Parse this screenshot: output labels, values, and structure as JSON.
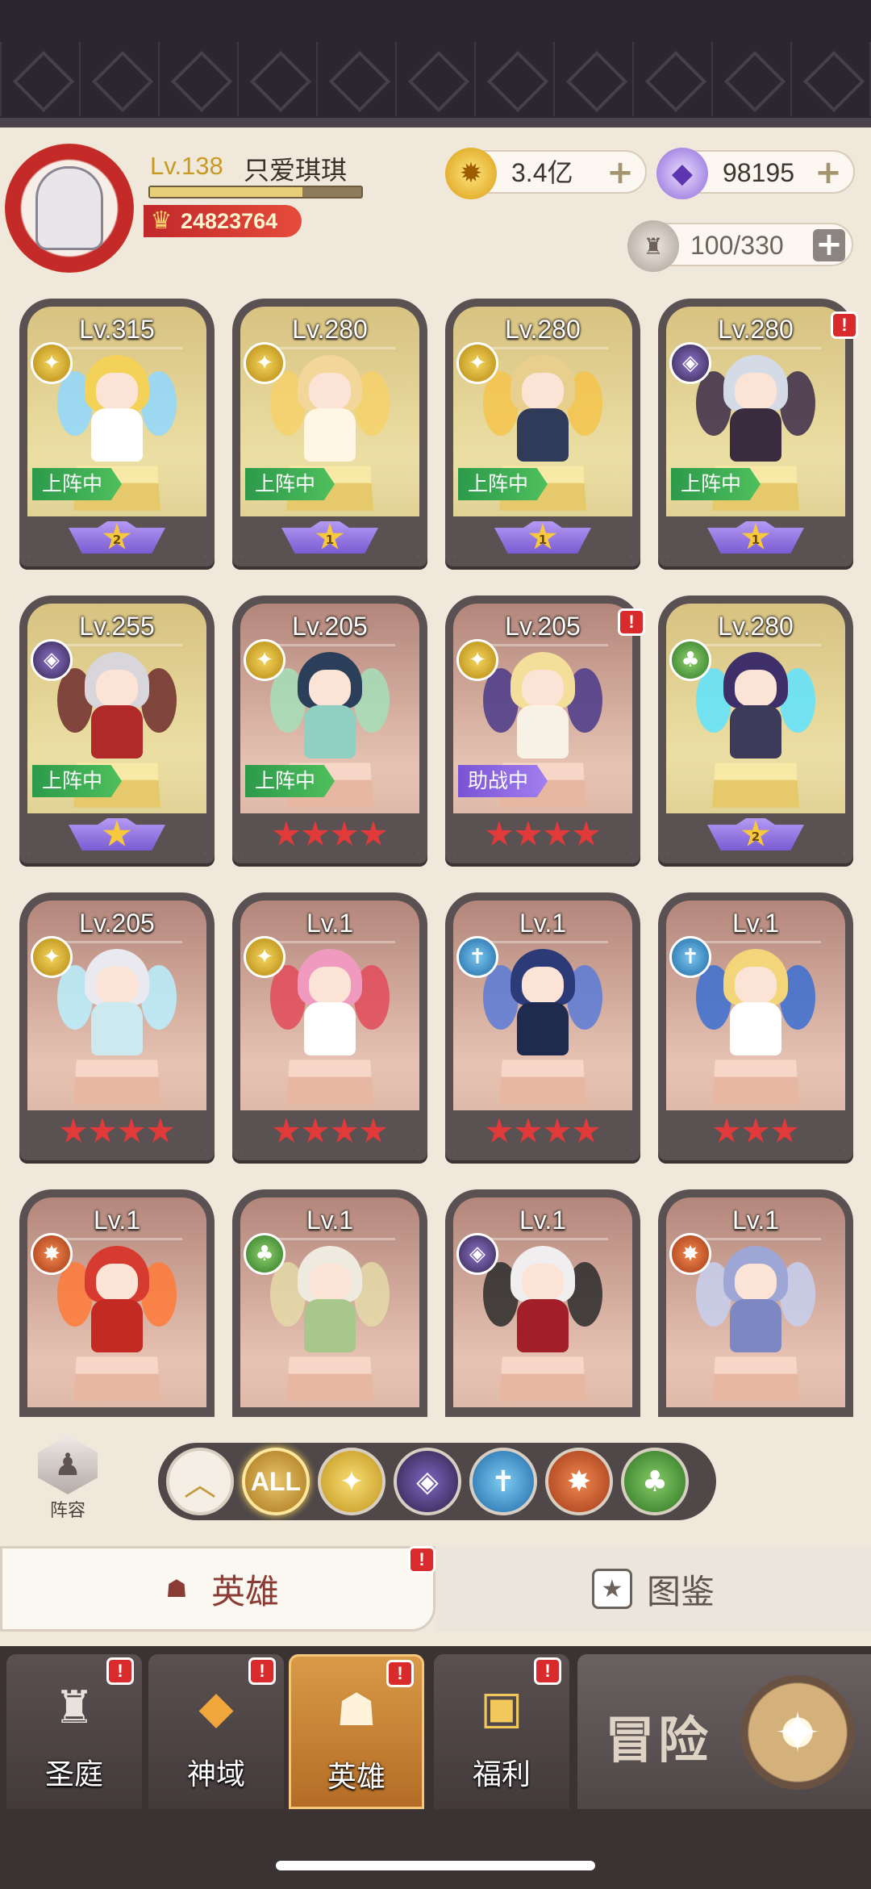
{
  "player": {
    "level": "Lv.138",
    "name": "只爱琪琪",
    "power": "24823764",
    "xp_fraction": 0.72
  },
  "resources": {
    "gold": "3.4亿",
    "gems": "98195",
    "capacity": "100/330"
  },
  "heroes": [
    {
      "level": "Lv.315",
      "faction": "gold",
      "status": "上阵中",
      "stars": "2",
      "badge": "purple",
      "alert": false
    },
    {
      "level": "Lv.280",
      "faction": "gold",
      "status": "上阵中",
      "stars": "1",
      "badge": "purple",
      "alert": false
    },
    {
      "level": "Lv.280",
      "faction": "gold",
      "status": "上阵中",
      "stars": "1",
      "badge": "purple",
      "alert": false
    },
    {
      "level": "Lv.280",
      "faction": "dark",
      "status": "上阵中",
      "stars": "1",
      "badge": "purple",
      "alert": true
    },
    {
      "level": "Lv.255",
      "faction": "dark",
      "status": "上阵中",
      "stars": "",
      "badge": "purple",
      "alert": false
    },
    {
      "level": "Lv.205",
      "faction": "gold",
      "status": "上阵中",
      "stars": 4,
      "badge": "red",
      "alert": false
    },
    {
      "level": "Lv.205",
      "faction": "gold",
      "status": "助战中",
      "stars": 4,
      "badge": "red",
      "alert": true
    },
    {
      "level": "Lv.280",
      "faction": "tree",
      "status": "",
      "stars": "2",
      "badge": "purple",
      "alert": false
    },
    {
      "level": "Lv.205",
      "faction": "gold",
      "status": "",
      "stars": 4,
      "badge": "red",
      "alert": false
    },
    {
      "level": "Lv.1",
      "faction": "gold",
      "status": "",
      "stars": 4,
      "badge": "red",
      "alert": false
    },
    {
      "level": "Lv.1",
      "faction": "blue",
      "status": "",
      "stars": 4,
      "badge": "red",
      "alert": false
    },
    {
      "level": "Lv.1",
      "faction": "blue",
      "status": "",
      "stars": 3,
      "badge": "red",
      "alert": false
    },
    {
      "level": "Lv.1",
      "faction": "fire",
      "status": "",
      "stars": 0,
      "badge": "red",
      "alert": false
    },
    {
      "level": "Lv.1",
      "faction": "tree",
      "status": "",
      "stars": 0,
      "badge": "red",
      "alert": false
    },
    {
      "level": "Lv.1",
      "faction": "dark",
      "status": "",
      "stars": 0,
      "badge": "red",
      "alert": false
    },
    {
      "level": "Lv.1",
      "faction": "fire",
      "status": "",
      "stars": 0,
      "badge": "red",
      "alert": false
    }
  ],
  "filters": {
    "lineup_label": "阵容",
    "all_label": "ALL",
    "icons": [
      "collapse-icon",
      "all",
      "light-faction-icon",
      "dark-faction-icon",
      "holy-faction-icon",
      "wild-faction-icon",
      "nature-faction-icon"
    ]
  },
  "subtabs": {
    "heroes": "英雄",
    "codex": "图鉴",
    "alert": "!"
  },
  "nav": {
    "sanctum": "圣庭",
    "divine": "神域",
    "heroes": "英雄",
    "welfare": "福利",
    "adventure": "冒险",
    "alert": "!"
  },
  "colors": {
    "accent": "#d99a48",
    "alert": "#d92b2b",
    "status_green": "#2c9a4a",
    "status_purple": "#7a53d6"
  }
}
